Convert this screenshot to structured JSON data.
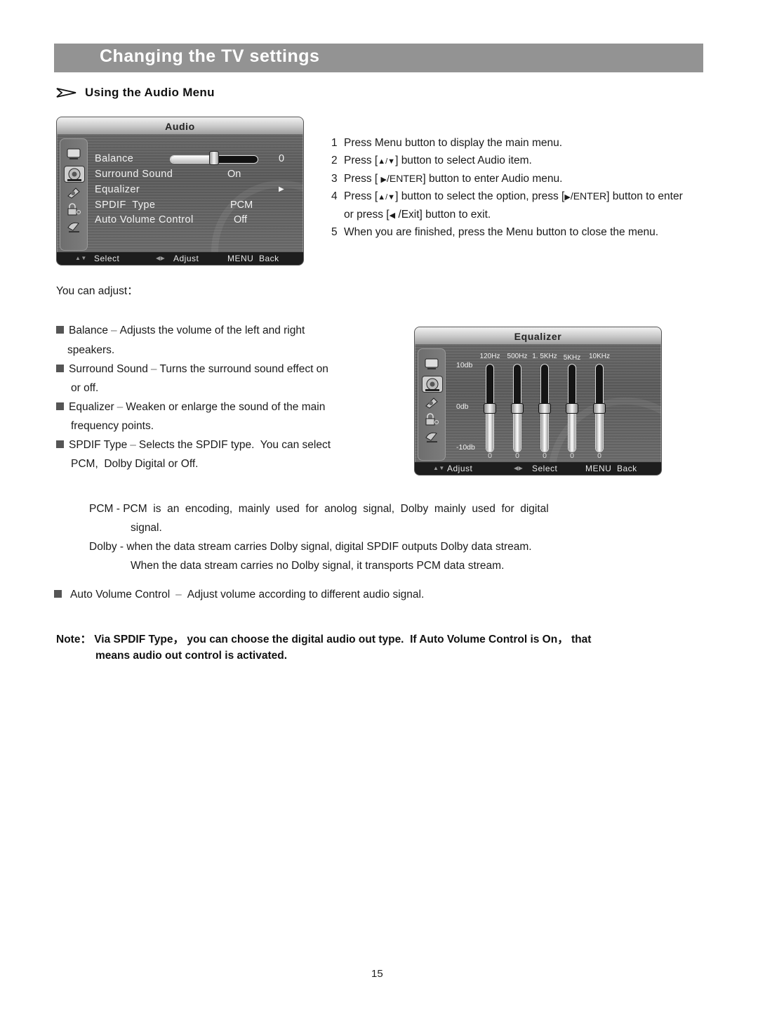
{
  "header": {
    "title": "Changing the TV settings"
  },
  "section": {
    "title": "Using the Audio Menu",
    "icon": "arrow-right-icon"
  },
  "audio_menu": {
    "title": "Audio",
    "sidebar_icons": [
      "picture-icon",
      "audio-icon",
      "setup-icon",
      "lock-icon",
      "channel-icon"
    ],
    "active_icon": "audio-icon",
    "items": [
      {
        "label": "Balance",
        "value": "0",
        "type": "slider",
        "level": 0.5
      },
      {
        "label": "Surround Sound",
        "value": "On"
      },
      {
        "label": "Equalizer",
        "value": "▶"
      },
      {
        "label": "SPDIF  Type",
        "value": "PCM"
      },
      {
        "label": "Auto Volume Control",
        "value": "Off"
      }
    ],
    "footer": {
      "select": "Select",
      "adjust": "Adjust",
      "back": "MENU  Back"
    }
  },
  "steps": [
    {
      "num": "1",
      "text": "Press Menu button to display the main menu."
    },
    {
      "num": "2",
      "pre": "Press [",
      "sym": "▲/▼",
      "post": "] button to select Audio item."
    },
    {
      "num": "3",
      "pre": "Press [ ",
      "sym": "▶",
      "enter": "/ENTER",
      "post": "] button to enter Audio menu."
    },
    {
      "num": "4",
      "pre": "Press [",
      "sym": "▲/▼",
      "mid": "] button to select the option, press [",
      "sym2": "▶",
      "enter": "/ENTER",
      "post": "] button to enter"
    },
    {
      "num": "",
      "pre": "or press [",
      "sym": "◀",
      "post": " /Exit] button to exit."
    },
    {
      "num": "5",
      "text": "When you are finished, press the Menu button to close the menu."
    }
  ],
  "you_can_adjust": "You can adjust：",
  "bullets": [
    {
      "term": "Balance",
      "desc": "Adjusts the volume of the left and right",
      "cont": "speakers."
    },
    {
      "term": "Surround Sound",
      "desc": "Turns the surround sound effect on",
      "cont": "or off."
    },
    {
      "term": "Equalizer",
      "desc": "Weaken or enlarge the sound of the main",
      "cont": "frequency points."
    },
    {
      "term": "SPDIF Type",
      "desc": "Selects the SPDIF type.  You can select",
      "cont": "PCM,  Dolby Digital or Off."
    }
  ],
  "equalizer_menu": {
    "title": "Equalizer",
    "db_labels": [
      "10db",
      "0db",
      "-10db"
    ],
    "bands": [
      {
        "label": "120Hz",
        "value": "0",
        "level_db": 0
      },
      {
        "label": "500Hz",
        "value": "0",
        "level_db": 0
      },
      {
        "label": "1. 5KHz",
        "value": "0",
        "level_db": 0
      },
      {
        "label": "5KHz",
        "value": "0",
        "level_db": 0
      },
      {
        "label": "10KHz",
        "value": "0",
        "level_db": 0
      }
    ],
    "footer": {
      "adjust": "Adjust",
      "select": "Select",
      "back": "MENU  Back"
    }
  },
  "spdif_details": [
    {
      "line1": "PCM - PCM  is  an  encoding,  mainly  used  for  anolog  signal,  Dolby  mainly  used  for  digital",
      "line2": "signal."
    },
    {
      "line1": "Dolby - when the data stream carries Dolby signal, digital SPDIF outputs Dolby data stream.",
      "line2": "When the data stream carries no Dolby signal, it transports PCM data stream."
    }
  ],
  "auto_volume": {
    "term": "Auto Volume Control",
    "desc": "Adjust volume according to different audio signal."
  },
  "note": {
    "line1": "Note： Via SPDIF Type， you can choose the digital audio out type.  If Auto Volume Control is On， that",
    "line2": "means audio out control is activated."
  },
  "page_number": "15"
}
